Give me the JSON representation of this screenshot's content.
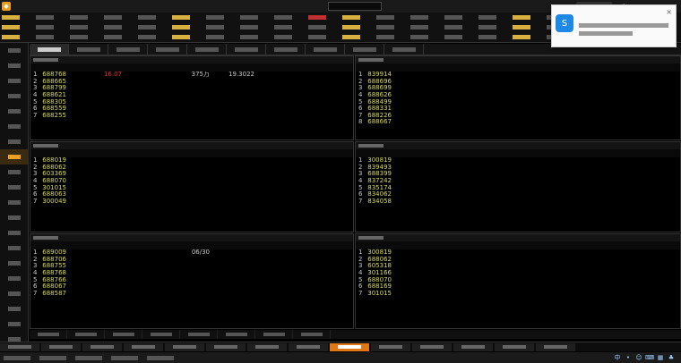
{
  "app": {
    "title": "",
    "search_placeholder": "",
    "login_label": ""
  },
  "colors": {
    "up": "#e83030",
    "down": "#30c030",
    "code": "#d8d860",
    "accent": "#f0a020",
    "cyan": "#3cc8d8"
  },
  "menu_rows": [
    [
      "",
      "",
      "",
      "",
      "",
      "",
      "",
      "",
      "",
      "",
      "",
      "",
      "",
      "",
      "",
      "",
      "",
      "",
      "",
      ""
    ],
    [
      "",
      "",
      "",
      "",
      "",
      "",
      "",
      "",
      "",
      "",
      "",
      "",
      "",
      "",
      "",
      "",
      "",
      "",
      "",
      ""
    ],
    [
      "",
      "",
      "",
      "",
      "",
      "",
      "",
      "",
      "",
      "",
      "",
      "",
      "",
      "",
      "",
      "",
      "",
      "",
      "",
      ""
    ]
  ],
  "sidebar": [
    "",
    "",
    "",
    "",
    "",
    "",
    "",
    "",
    "",
    "",
    "",
    "",
    "",
    "",
    "",
    "",
    "",
    "",
    "",
    ""
  ],
  "tabs": [
    "",
    "",
    "",
    "",
    "",
    "",
    "",
    "",
    "",
    ""
  ],
  "panels": [
    {
      "title": "",
      "headers": [
        "",
        "",
        "",
        "",
        "",
        "",
        "",
        ""
      ],
      "rows": [
        [
          "1",
          "688768",
          "",
          "16.07",
          "",
          "",
          "375万",
          "19.3022"
        ],
        [
          "2",
          "688665",
          "",
          "",
          "",
          "",
          "",
          ""
        ],
        [
          "3",
          "688799",
          "",
          "",
          "",
          "",
          "",
          ""
        ],
        [
          "4",
          "688621",
          "",
          "",
          "",
          "",
          "",
          ""
        ],
        [
          "5",
          "688305",
          "",
          "",
          "",
          "",
          "",
          ""
        ],
        [
          "6",
          "688559",
          "",
          "",
          "",
          "",
          "",
          ""
        ],
        [
          "7",
          "688255",
          "",
          "",
          "",
          "",
          "",
          ""
        ]
      ]
    },
    {
      "title": "",
      "headers": [
        "",
        "",
        "",
        "",
        "",
        "",
        "",
        ""
      ],
      "rows": [
        [
          "1",
          "839914",
          "",
          "",
          "",
          "",
          "",
          ""
        ],
        [
          "2",
          "688696",
          "",
          "",
          "",
          "",
          "",
          ""
        ],
        [
          "3",
          "688699",
          "",
          "",
          "",
          "",
          "",
          ""
        ],
        [
          "4",
          "688626",
          "",
          "",
          "",
          "",
          "",
          ""
        ],
        [
          "5",
          "688499",
          "",
          "",
          "",
          "",
          "",
          ""
        ],
        [
          "6",
          "688331",
          "",
          "",
          "",
          "",
          "",
          ""
        ],
        [
          "7",
          "688226",
          "",
          "",
          "",
          "",
          "",
          ""
        ],
        [
          "8",
          "688667",
          "",
          "",
          "",
          "",
          "",
          ""
        ]
      ]
    },
    {
      "title": "",
      "headers": [
        "",
        "",
        "",
        "",
        "",
        "",
        "",
        ""
      ],
      "rows": [
        [
          "1",
          "688019",
          "",
          "",
          "",
          "",
          "",
          ""
        ],
        [
          "2",
          "688062",
          "",
          "",
          "",
          "",
          "",
          ""
        ],
        [
          "3",
          "603369",
          "",
          "",
          "",
          "",
          "",
          ""
        ],
        [
          "4",
          "688070",
          "",
          "",
          "",
          "",
          "",
          ""
        ],
        [
          "5",
          "301015",
          "",
          "",
          "",
          "",
          "",
          ""
        ],
        [
          "6",
          "688063",
          "",
          "",
          "",
          "",
          "",
          ""
        ],
        [
          "7",
          "300049",
          "",
          "",
          "",
          "",
          "",
          ""
        ]
      ]
    },
    {
      "title": "",
      "headers": [
        "",
        "",
        "",
        "",
        "",
        "",
        "",
        ""
      ],
      "rows": [
        [
          "1",
          "300819",
          "",
          "",
          "",
          "",
          "",
          ""
        ],
        [
          "2",
          "839493",
          "",
          "",
          "",
          "",
          "",
          ""
        ],
        [
          "3",
          "688399",
          "",
          "",
          "",
          "",
          "",
          ""
        ],
        [
          "4",
          "837242",
          "",
          "",
          "",
          "",
          "",
          ""
        ],
        [
          "5",
          "835174",
          "",
          "",
          "",
          "",
          "",
          ""
        ],
        [
          "6",
          "834062",
          "",
          "",
          "",
          "",
          "",
          ""
        ],
        [
          "7",
          "834058",
          "",
          "",
          "",
          "",
          "",
          ""
        ]
      ]
    },
    {
      "title": "",
      "headers": [
        "",
        "",
        "",
        "",
        "",
        "",
        "",
        ""
      ],
      "rows": [
        [
          "1",
          "689009",
          "",
          "",
          "",
          "",
          "06/30",
          ""
        ],
        [
          "2",
          "688706",
          "",
          "",
          "",
          "",
          "",
          ""
        ],
        [
          "3",
          "688755",
          "",
          "",
          "",
          "",
          "",
          ""
        ],
        [
          "4",
          "688768",
          "",
          "",
          "",
          "",
          "",
          ""
        ],
        [
          "5",
          "688766",
          "",
          "",
          "",
          "",
          "",
          ""
        ],
        [
          "6",
          "688067",
          "",
          "",
          "",
          "",
          "",
          ""
        ],
        [
          "7",
          "688587",
          "",
          "",
          "",
          "",
          "",
          ""
        ]
      ]
    },
    {
      "title": "",
      "headers": [
        "",
        "",
        "",
        "",
        "",
        "",
        "",
        ""
      ],
      "rows": [
        [
          "1",
          "300819",
          "",
          "",
          "",
          "",
          "",
          ""
        ],
        [
          "2",
          "688062",
          "",
          "",
          "",
          "",
          "",
          ""
        ],
        [
          "3",
          "605318",
          "",
          "",
          "",
          "",
          "",
          ""
        ],
        [
          "4",
          "301166",
          "",
          "",
          "",
          "",
          "",
          ""
        ],
        [
          "5",
          "688070",
          "",
          "",
          "",
          "",
          "",
          ""
        ],
        [
          "6",
          "688169",
          "",
          "",
          "",
          "",
          "",
          ""
        ],
        [
          "7",
          "301015",
          "",
          "",
          "",
          "",
          "",
          ""
        ]
      ]
    }
  ],
  "subtabs": [
    "",
    "",
    "",
    "",
    "",
    "",
    "",
    ""
  ],
  "toolbar": [
    "",
    "",
    "",
    "",
    "",
    "",
    "",
    "",
    "",
    "",
    "",
    "",
    "",
    ""
  ],
  "status": [
    "",
    "",
    "",
    "",
    ""
  ],
  "notice": {
    "line1": "",
    "line2": ""
  }
}
